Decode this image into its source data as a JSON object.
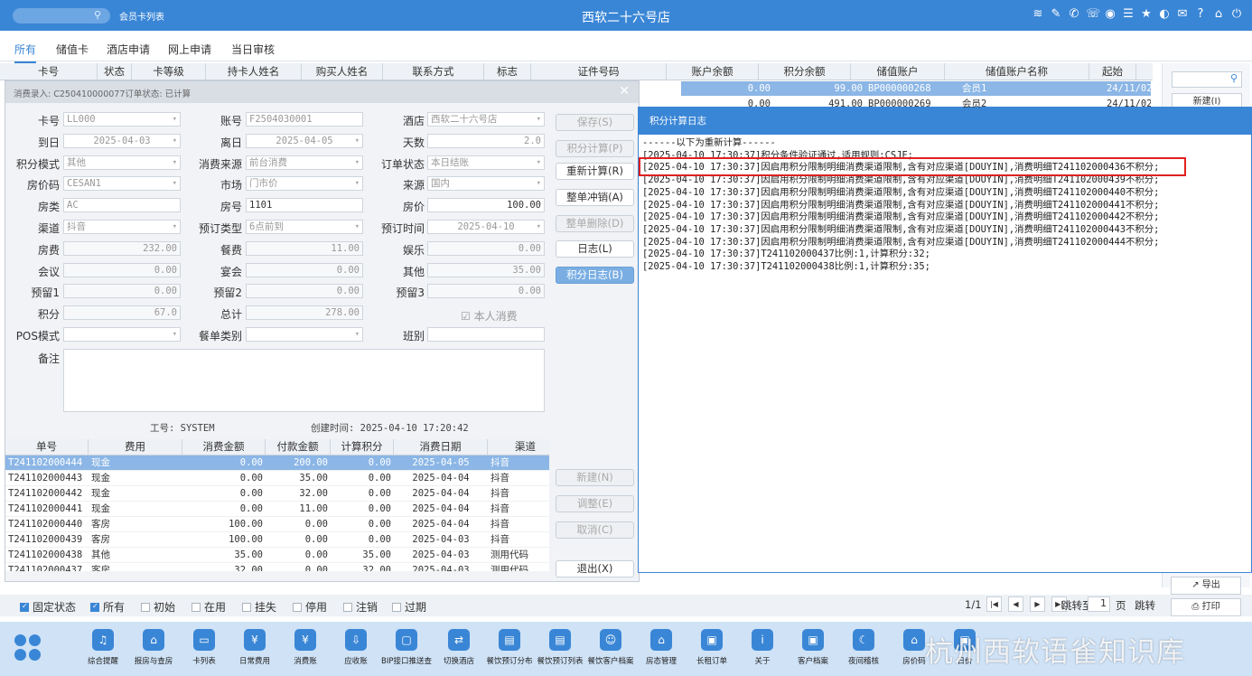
{
  "top": {
    "crumb": "会员卡列表",
    "title": "西软二十六号店",
    "icons": [
      "wifi-icon",
      "tools-icon",
      "phone-icon",
      "call-icon",
      "palette-icon",
      "menu-icon",
      "star-icon",
      "contrast-icon",
      "mail-icon",
      "help-icon",
      "home-icon",
      "power-icon"
    ]
  },
  "tabs": [
    "所有",
    "储值卡",
    "酒店申请",
    "网上申请",
    "当日审核"
  ],
  "bg_header": [
    "卡号",
    "状态",
    "卡等级",
    "持卡人姓名",
    "购买人姓名",
    "联系方式",
    "标志",
    "证件号码",
    "账户余额",
    "积分余额",
    "储值账户",
    "储值账户名称",
    "起始"
  ],
  "bg_rows": [
    [
      "0.00",
      "99.00",
      "BP000000268",
      "会员1",
      "24/11/02"
    ],
    [
      "0.00",
      "491.00",
      "BP000000269",
      "会员2",
      "24/11/02"
    ]
  ],
  "side": {
    "new": "新建(I)"
  },
  "dialog": {
    "title": "消费录入: C250410000077订单状态: 已计算",
    "fields": {
      "card_no": [
        "卡号",
        "LL000"
      ],
      "account": [
        "账号",
        "F2504030001"
      ],
      "hotel": [
        "酒店",
        "西软二十六号店"
      ],
      "arr": [
        "到日",
        "2025-04-03"
      ],
      "dep": [
        "离日",
        "2025-04-05"
      ],
      "days": [
        "天数",
        "2.0"
      ],
      "mode": [
        "积分模式",
        "其他"
      ],
      "src": [
        "消费来源",
        "前台消费"
      ],
      "status": [
        "订单状态",
        "本日结账"
      ],
      "rate": [
        "房价码",
        "CESAN1"
      ],
      "market": [
        "市场",
        "门市价"
      ],
      "source": [
        "来源",
        "国内"
      ],
      "rtype": [
        "房类",
        "AC"
      ],
      "room": [
        "房号",
        "1101"
      ],
      "price": [
        "房价",
        "100.00"
      ],
      "channel": [
        "渠道",
        "抖音"
      ],
      "booktype": [
        "预订类型",
        "6点前到"
      ],
      "booktime": [
        "预订时间",
        "2025-04-10"
      ],
      "roomfee": [
        "房费",
        "232.00"
      ],
      "food": [
        "餐费",
        "11.00"
      ],
      "ent": [
        "娱乐",
        "0.00"
      ],
      "meet": [
        "会议",
        "0.00"
      ],
      "banquet": [
        "宴会",
        "0.00"
      ],
      "other": [
        "其他",
        "35.00"
      ],
      "r1": [
        "预留1",
        "0.00"
      ],
      "r2": [
        "预留2",
        "0.00"
      ],
      "r3": [
        "预留3",
        "0.00"
      ],
      "points": [
        "积分",
        "67.0"
      ],
      "total": [
        "总计",
        "278.00"
      ],
      "pos": [
        "POS模式",
        ""
      ],
      "billtype": [
        "餐单类别",
        ""
      ],
      "shift": [
        "班别",
        ""
      ],
      "note": [
        "备注",
        ""
      ]
    },
    "self": "本人消费",
    "worker": "工号: SYSTEM",
    "created": "创建时间: 2025-04-10 17:20:42",
    "buttons": [
      "保存(S)",
      "积分计算(P)",
      "重新计算(R)",
      "整单冲销(A)",
      "整单删除(D)",
      "日志(L)",
      "积分日志(B)",
      "新建(N)",
      "调整(E)",
      "取消(C)",
      "退出(X)"
    ],
    "grid_header": [
      "单号",
      "费用",
      "消费金额",
      "付款金额",
      "计算积分",
      "消费日期",
      "渠道"
    ],
    "grid_rows": [
      [
        "T241102000444",
        "现金",
        "0.00",
        "200.00",
        "0.00",
        "2025-04-05",
        "抖音"
      ],
      [
        "T241102000443",
        "现金",
        "0.00",
        "35.00",
        "0.00",
        "2025-04-04",
        "抖音"
      ],
      [
        "T241102000442",
        "现金",
        "0.00",
        "32.00",
        "0.00",
        "2025-04-04",
        "抖音"
      ],
      [
        "T241102000441",
        "现金",
        "0.00",
        "11.00",
        "0.00",
        "2025-04-04",
        "抖音"
      ],
      [
        "T241102000440",
        "客房",
        "100.00",
        "0.00",
        "0.00",
        "2025-04-04",
        "抖音"
      ],
      [
        "T241102000439",
        "客房",
        "100.00",
        "0.00",
        "0.00",
        "2025-04-03",
        "抖音"
      ],
      [
        "T241102000438",
        "其他",
        "35.00",
        "0.00",
        "35.00",
        "2025-04-03",
        "测用代码"
      ],
      [
        "T241102000437",
        "客房",
        "32.00",
        "0.00",
        "32.00",
        "2025-04-03",
        "测用代码"
      ]
    ]
  },
  "log": {
    "title": "积分计算日志",
    "lines": [
      "------以下为重新计算------",
      "[2025-04-10 17:30:37]积分条件验证通过,适用规则:CSJF;",
      "[2025-04-10 17:30:37]因启用积分限制明细消费渠道限制,含有对应渠道[DOUYIN],消费明细T241102000436不积分;",
      "[2025-04-10 17:30:37]因启用积分限制明细消费渠道限制,含有对应渠道[DOUYIN],消费明细T241102000439不积分;",
      "[2025-04-10 17:30:37]因启用积分限制明细消费渠道限制,含有对应渠道[DOUYIN],消费明细T241102000440不积分;",
      "[2025-04-10 17:30:37]因启用积分限制明细消费渠道限制,含有对应渠道[DOUYIN],消费明细T241102000441不积分;",
      "[2025-04-10 17:30:37]因启用积分限制明细消费渠道限制,含有对应渠道[DOUYIN],消费明细T241102000442不积分;",
      "[2025-04-10 17:30:37]因启用积分限制明细消费渠道限制,含有对应渠道[DOUYIN],消费明细T241102000443不积分;",
      "[2025-04-10 17:30:37]因启用积分限制明细消费渠道限制,含有对应渠道[DOUYIN],消费明细T241102000444不积分;",
      "[2025-04-10 17:30:37]T241102000437比例:1,计算积分:32;",
      "[2025-04-10 17:30:37]T241102000438比例:1,计算积分:35;"
    ]
  },
  "filters": [
    {
      "label": "固定状态",
      "checked": true
    },
    {
      "label": "所有",
      "checked": true
    },
    {
      "label": "初始",
      "checked": false
    },
    {
      "label": "在用",
      "checked": false
    },
    {
      "label": "挂失",
      "checked": false
    },
    {
      "label": "停用",
      "checked": false
    },
    {
      "label": "注销",
      "checked": false
    },
    {
      "label": "过期",
      "checked": false
    }
  ],
  "pager": {
    "pages": "1/1",
    "goto": "跳转至",
    "page": "1",
    "unit": "页",
    "jump": "跳转"
  },
  "export": "导出",
  "print": "打印",
  "dock": [
    "综合提醒",
    "报房与查房",
    "卡列表",
    "日常费用",
    "消费账",
    "应收账",
    "BIP接口推送查",
    "切换酒店",
    "餐饮预订分布",
    "餐饮预订列表",
    "餐饮客户档案",
    "房态管理",
    "长租订单",
    "关于",
    "客户档案",
    "夜间稽核",
    "房价码",
    "日价"
  ],
  "watermark": "杭州西软语雀知识库"
}
